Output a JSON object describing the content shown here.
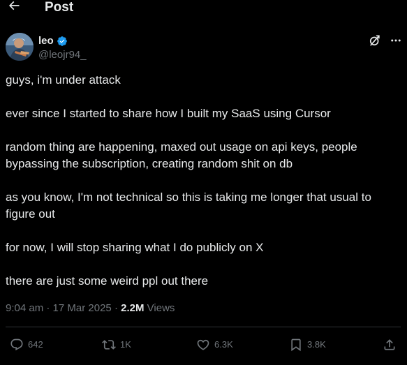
{
  "header": {
    "title": "Post"
  },
  "author": {
    "display_name": "leo",
    "handle": "@leojr94_",
    "verified_color": "#1d9bf0"
  },
  "tweet": {
    "paragraphs": [
      "guys, i'm under attack",
      "ever since I started to share how I built my SaaS using Cursor",
      "random thing are happening, maxed out usage on api keys, people bypassing the subscription, creating random shit on db",
      "as you know, I'm not technical so this is taking me longer that usual to figure out",
      "for now, I will stop sharing what I do publicly on X",
      "there are just some weird ppl out there"
    ]
  },
  "meta": {
    "time": "9:04 am",
    "separator": "·",
    "date": "17 Mar 2025",
    "views_count": "2.2M",
    "views_label": "Views"
  },
  "actions": {
    "replies": "642",
    "reposts": "1K",
    "likes": "6.3K",
    "bookmarks": "3.8K"
  },
  "icons": {
    "back": "arrow-left-icon",
    "verified": "verified-badge-icon",
    "grok": "grok-icon",
    "more": "more-dots-icon",
    "reply": "reply-icon",
    "repost": "repost-icon",
    "like": "heart-icon",
    "bookmark": "bookmark-icon",
    "share": "share-icon"
  },
  "colors": {
    "background": "#000000",
    "text_primary": "#e7e9ea",
    "text_secondary": "#71767b",
    "divider": "#2f3336",
    "accent": "#1d9bf0"
  }
}
